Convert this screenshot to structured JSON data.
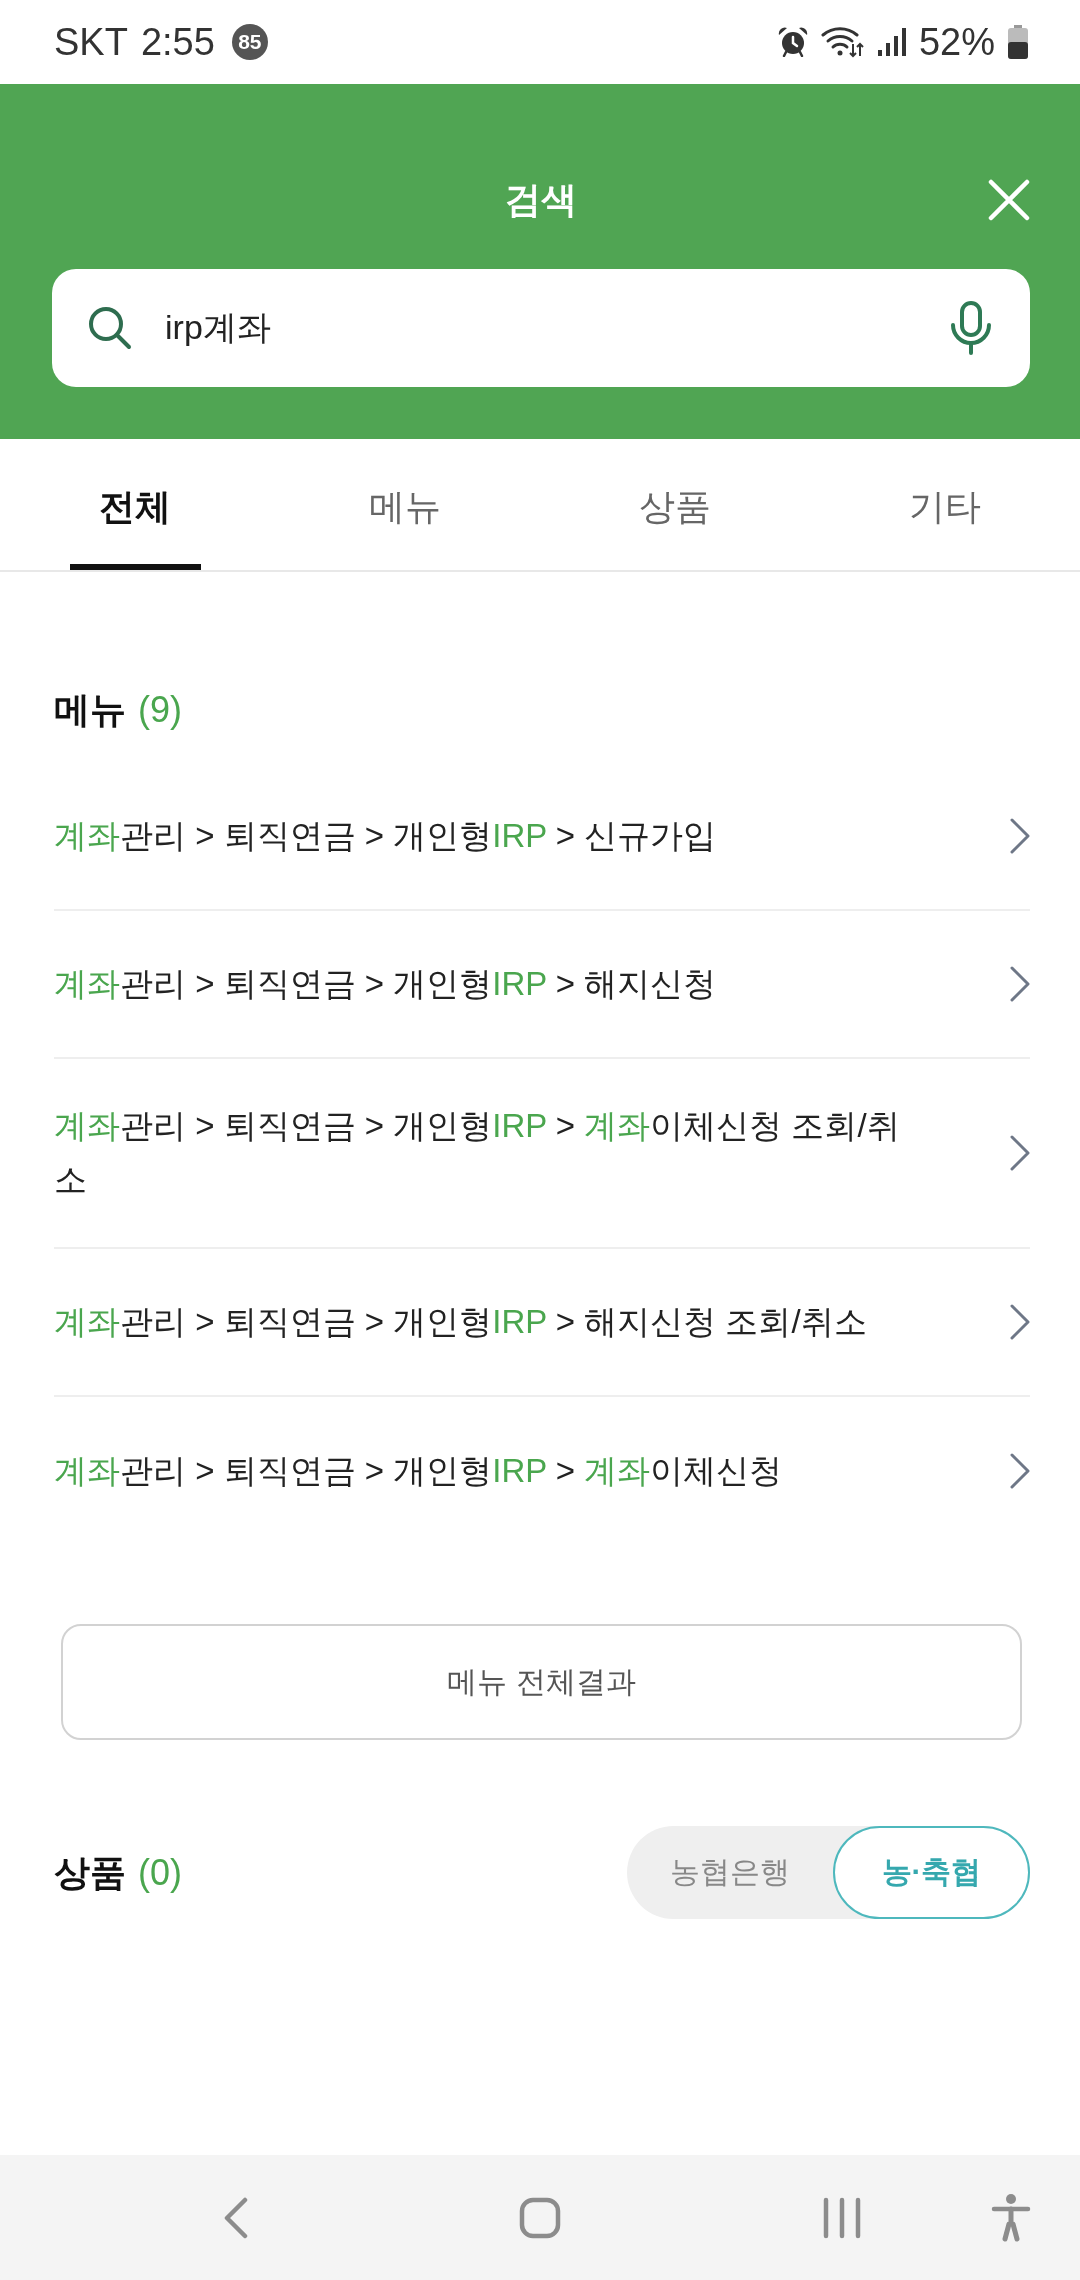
{
  "status_bar": {
    "carrier": "SKT",
    "time": "2:55",
    "notification_count": "85",
    "battery": "52%"
  },
  "header": {
    "title": "검색"
  },
  "search": {
    "value": "irp계좌"
  },
  "tabs": [
    {
      "label": "전체",
      "selected": true
    },
    {
      "label": "메뉴",
      "selected": false
    },
    {
      "label": "상품",
      "selected": false
    },
    {
      "label": "기타",
      "selected": false
    }
  ],
  "menu_section": {
    "title": "메뉴",
    "count": "(9)",
    "results": [
      {
        "segments": [
          {
            "text": "계좌",
            "match": true
          },
          {
            "text": "관리 > 퇴직연금 > 개인형",
            "match": false
          },
          {
            "text": "IRP",
            "match": true
          },
          {
            "text": " > 신규가입",
            "match": false
          }
        ]
      },
      {
        "segments": [
          {
            "text": "계좌",
            "match": true
          },
          {
            "text": "관리 > 퇴직연금 > 개인형",
            "match": false
          },
          {
            "text": "IRP",
            "match": true
          },
          {
            "text": " > 해지신청",
            "match": false
          }
        ]
      },
      {
        "segments": [
          {
            "text": "계좌",
            "match": true
          },
          {
            "text": "관리 > 퇴직연금 > 개인형",
            "match": false
          },
          {
            "text": "IRP",
            "match": true
          },
          {
            "text": " > ",
            "match": false
          },
          {
            "text": "계좌",
            "match": true
          },
          {
            "text": "이체신청 조회/취소",
            "match": false
          }
        ]
      },
      {
        "segments": [
          {
            "text": "계좌",
            "match": true
          },
          {
            "text": "관리 > 퇴직연금 > 개인형",
            "match": false
          },
          {
            "text": "IRP",
            "match": true
          },
          {
            "text": " > 해지신청 조회/취소",
            "match": false
          }
        ]
      },
      {
        "segments": [
          {
            "text": "계좌",
            "match": true
          },
          {
            "text": "관리 > 퇴직연금 > 개인형",
            "match": false
          },
          {
            "text": "IRP",
            "match": true
          },
          {
            "text": " > ",
            "match": false
          },
          {
            "text": "계좌",
            "match": true
          },
          {
            "text": "이체신청",
            "match": false
          }
        ]
      }
    ],
    "more_button": "메뉴 전체결과"
  },
  "product_section": {
    "title": "상품",
    "count": "(0)",
    "filters": [
      {
        "label": "농협은행",
        "selected": false
      },
      {
        "label": "농·축협",
        "selected": true
      }
    ]
  }
}
